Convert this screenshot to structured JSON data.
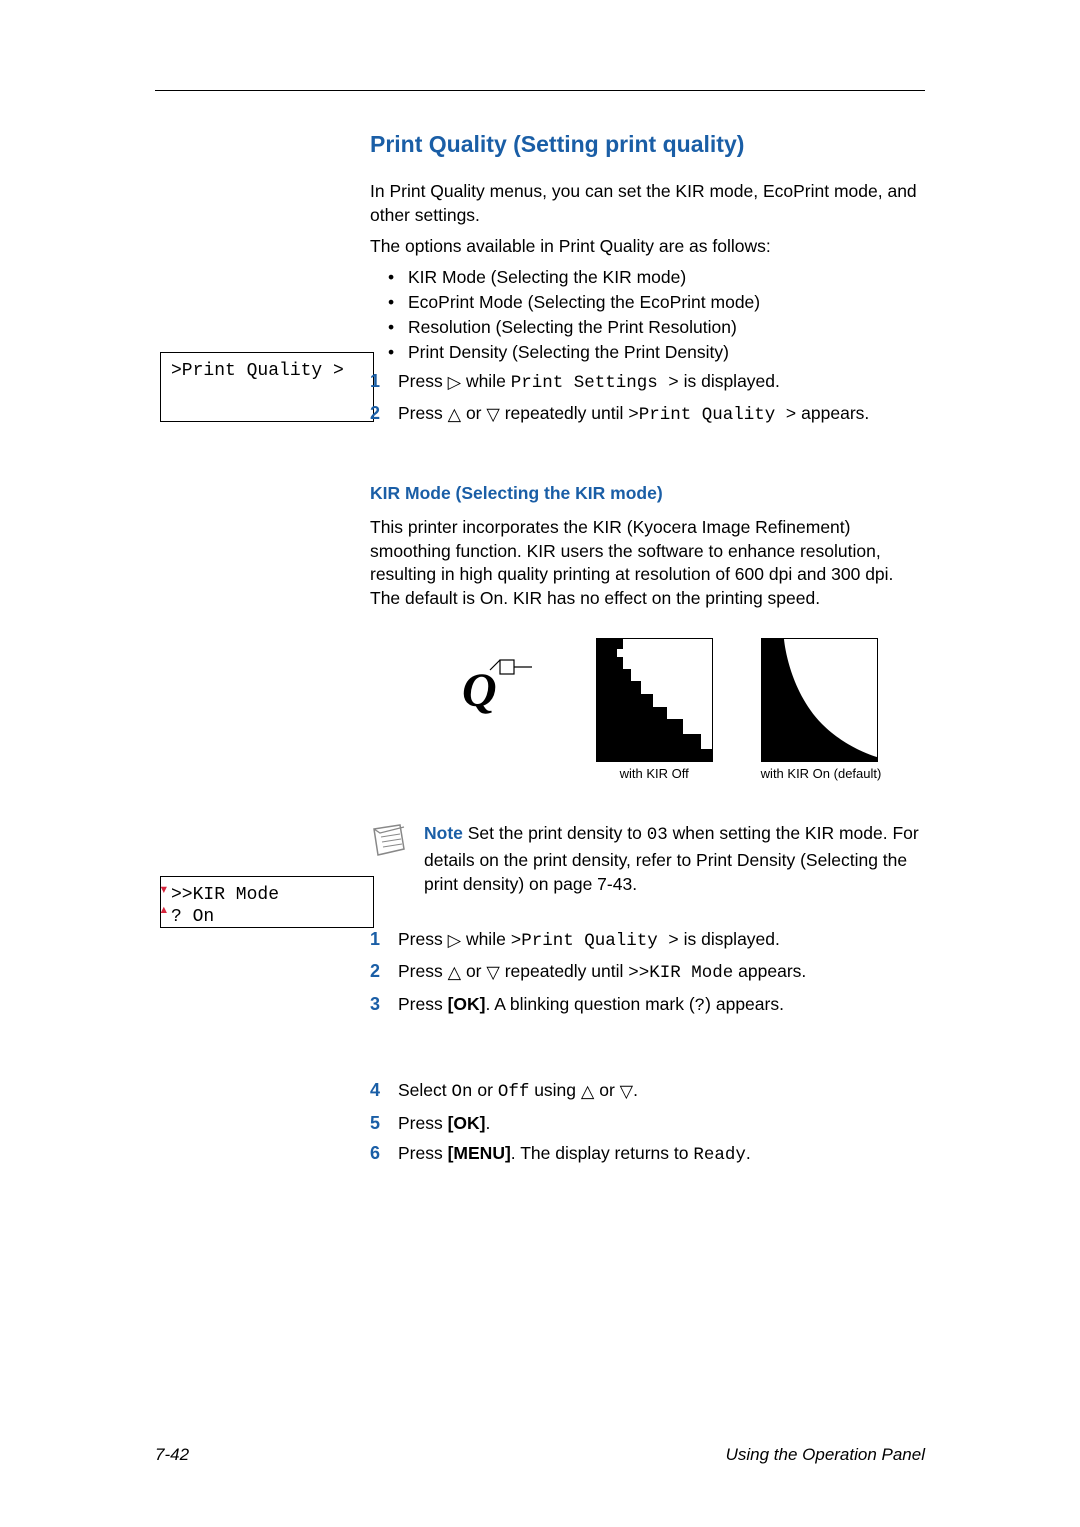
{
  "heading": "Print Quality (Setting print quality)",
  "intro1": "In Print Quality menus, you can set the KIR mode, EcoPrint mode, and other settings.",
  "intro2": "The options available in Print Quality are as follows:",
  "bullets": [
    "KIR Mode (Selecting the KIR mode)",
    "EcoPrint Mode (Selecting the EcoPrint mode)",
    "Resolution (Selecting the Print Resolution)",
    "Print Density (Selecting the Print Density)"
  ],
  "stepsA": {
    "s1_pre": "Press ",
    "s1_mid": " while ",
    "s1_code": "Print Settings >",
    "s1_post": " is displayed.",
    "s2_pre": "Press ",
    "s2_mid": " or ",
    "s2_mid2": " repeatedly until ",
    "s2_code": ">Print Quality >",
    "s2_post": " appears."
  },
  "panel1": ">Print Quality >",
  "sub": "KIR Mode (Selecting the KIR mode)",
  "kir_para": "This printer incorporates the KIR (Kyocera Image Refinement) smoothing function. KIR users the software to enhance resolution, resulting in high quality printing at resolution of 600 dpi and 300 dpi. The default is On. KIR has no effect on the printing speed.",
  "cap_off": "with KIR Off",
  "cap_on": "with KIR On (default)",
  "note": {
    "label": "Note",
    "t1": "  Set the print density to ",
    "code": "03",
    "t2": " when setting the KIR mode. For details on the print density, refer to Print Density (Selecting the print density) on page 7-43."
  },
  "stepsB": {
    "s1_pre": "Press ",
    "s1_mid": " while ",
    "s1_code": ">Print Quality >",
    "s1_post": " is displayed.",
    "s2_pre": "Press ",
    "s2_mid": " or ",
    "s2_mid2": " repeatedly until ",
    "s2_code": ">>KIR Mode",
    "s2_post": " appears.",
    "s3_pre": "Press ",
    "s3_ok": "[OK]",
    "s3_mid": ". A blinking question mark (",
    "s3_code": "?",
    "s3_post": ") appears.",
    "s4_pre": "Select ",
    "s4_on": "On",
    "s4_or": " or ",
    "s4_off": "Off",
    "s4_using": " using ",
    "s4_or2": " or ",
    "s4_post": ".",
    "s5_pre": "Press ",
    "s5_ok": "[OK]",
    "s5_post": ".",
    "s6_pre": "Press ",
    "s6_menu": "[MENU]",
    "s6_mid": ". The display returns to ",
    "s6_code": "Ready",
    "s6_post": "."
  },
  "panel2_l1": ">>KIR Mode",
  "panel2_l2": "? On",
  "footer_left": "7-42",
  "footer_right": "Using the Operation Panel"
}
